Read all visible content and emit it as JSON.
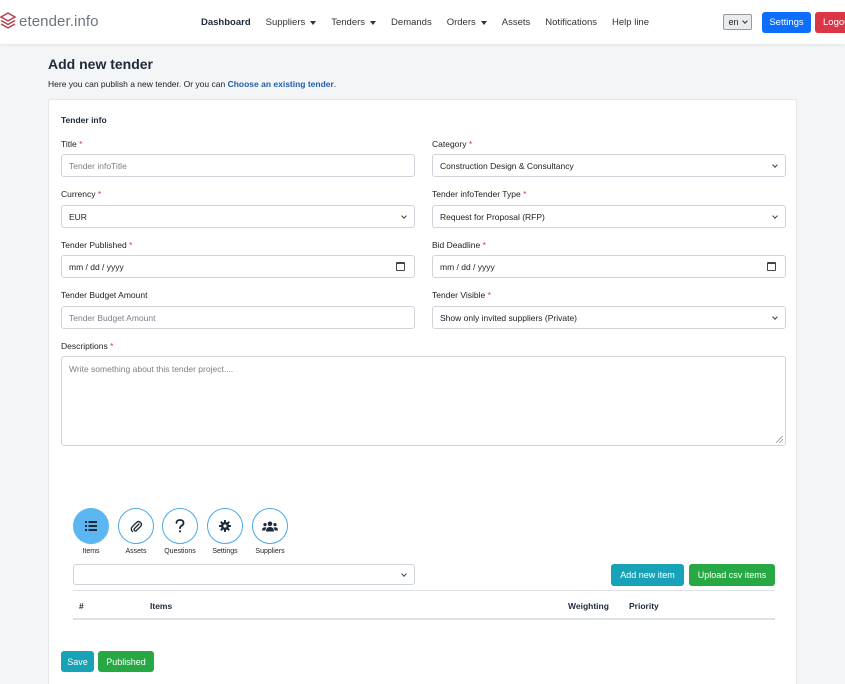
{
  "brand": {
    "name": "etender.info",
    "icon": "layers-logo-icon"
  },
  "nav": {
    "items": [
      {
        "label": "Dashboard",
        "active": true,
        "dropdown": false
      },
      {
        "label": "Suppliers",
        "active": false,
        "dropdown": true
      },
      {
        "label": "Tenders",
        "active": false,
        "dropdown": true
      },
      {
        "label": "Demands",
        "active": false,
        "dropdown": false
      },
      {
        "label": "Orders",
        "active": false,
        "dropdown": true
      },
      {
        "label": "Assets",
        "active": false,
        "dropdown": false
      },
      {
        "label": "Notifications",
        "active": false,
        "dropdown": false
      },
      {
        "label": "Help line",
        "active": false,
        "dropdown": false
      }
    ],
    "language": "en",
    "settings_label": "Settings",
    "logout_label": "Logout"
  },
  "header": {
    "title": "Add new tender",
    "subtitle_prefix": "Here you can publish a new tender. Or you can ",
    "subtitle_link": "Choose an existing tender",
    "subtitle_suffix": "."
  },
  "form": {
    "section_title": "Tender info",
    "title_label": "Title",
    "title_placeholder": "Tender infoTitle",
    "category_label": "Category",
    "category_value": "Construction Design & Consultancy",
    "currency_label": "Currency",
    "currency_value": "EUR",
    "tender_type_label": "Tender infoTender Type",
    "tender_type_value": "Request for Proposal (RFP)",
    "published_label": "Tender Published",
    "published_placeholder": "mm / dd / yyyy",
    "deadline_label": "Bid Deadline",
    "deadline_placeholder": "mm / dd / yyyy",
    "budget_label": "Tender Budget Amount",
    "budget_placeholder": "Tender Budget Amount",
    "visible_label": "Tender Visible",
    "visible_value": "Show only invited suppliers (Private)",
    "descriptions_label": "Descriptions",
    "descriptions_placeholder": "Write something about this tender project....",
    "required_mark": "*"
  },
  "tabs": [
    {
      "label": "Items",
      "icon": "list-icon",
      "active": true
    },
    {
      "label": "Assets",
      "icon": "paperclip-icon",
      "active": false
    },
    {
      "label": "Questions",
      "icon": "question-icon",
      "active": false
    },
    {
      "label": "Settings",
      "icon": "gear-icon",
      "active": false
    },
    {
      "label": "Suppliers",
      "icon": "users-icon",
      "active": false
    }
  ],
  "items_panel": {
    "add_item_label": "Add new item",
    "upload_csv_label": "Upload csv items",
    "columns": [
      "#",
      "Items",
      "Weighting",
      "Priority"
    ]
  },
  "footer": {
    "save_label": "Save",
    "published_label": "Published"
  },
  "colors": {
    "primary": "#0d6efd",
    "danger": "#dc3545",
    "info": "#17a2b8",
    "success": "#28a745",
    "tab_active": "#5cb6f2"
  }
}
